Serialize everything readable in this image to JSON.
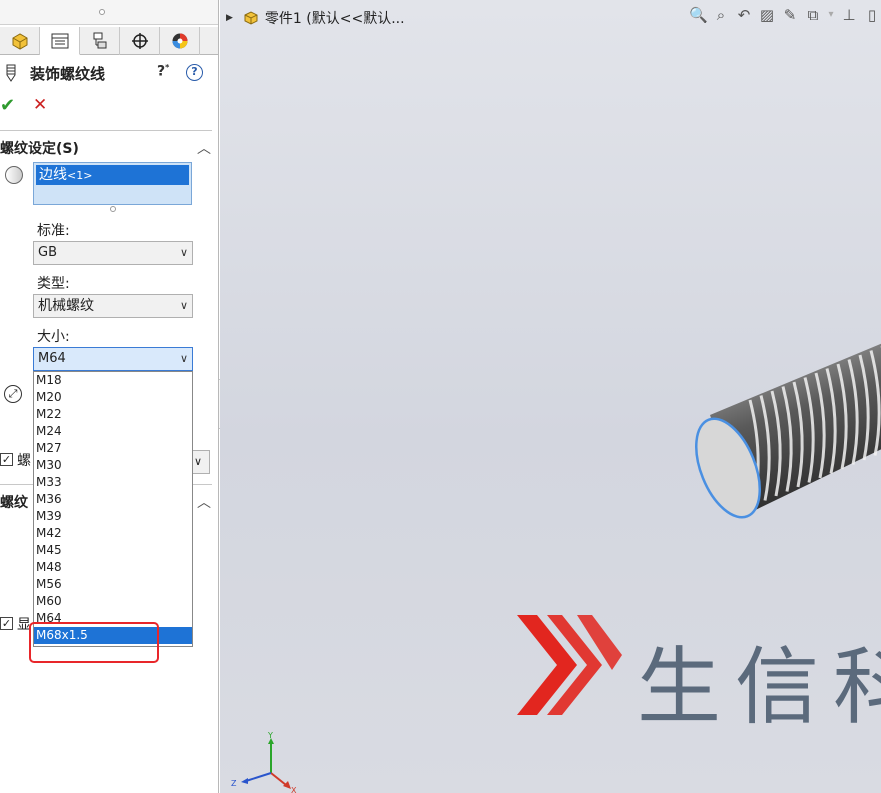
{
  "tabs": [
    {
      "name": "feature-manager-tab",
      "icon": "feature-manager-icon"
    },
    {
      "name": "property-manager-tab",
      "icon": "property-manager-icon"
    },
    {
      "name": "configuration-manager-tab",
      "icon": "configuration-icon"
    },
    {
      "name": "dimxpert-tab",
      "icon": "dimxpert-icon"
    },
    {
      "name": "display-manager-tab",
      "icon": "display-manager-icon"
    }
  ],
  "property_manager": {
    "title": "装饰螺纹线",
    "help_label": "?",
    "help2_label": "?",
    "ok_label": "✔",
    "cancel_label": "✕"
  },
  "thread_settings": {
    "section_title": "螺纹设定(S)",
    "selection_item": "边线",
    "selection_suffix": "<1>",
    "standard_label": "标准:",
    "standard_value": "GB",
    "type_label": "类型:",
    "type_value": "机械螺纹",
    "size_label": "大小:",
    "size_value": "M64",
    "size_options": [
      "M18",
      "M20",
      "M22",
      "M24",
      "M27",
      "M30",
      "M33",
      "M36",
      "M39",
      "M42",
      "M45",
      "M48",
      "M56",
      "M60",
      "M64",
      "M68x1.5"
    ],
    "size_selected": "M68x1.5"
  },
  "partial_labels": {
    "thread_callout": "螺",
    "thread_callout_section": "螺纹",
    "display_checkbox": "显"
  },
  "viewport": {
    "tree_text": "零件1  (默认<<默认...",
    "watermark_text": "生信科",
    "triad_x": "X",
    "triad_y": "Y",
    "triad_z": "Z"
  },
  "colors": {
    "selection_blue": "#1e73d6",
    "highlight_red": "#e8262a",
    "ok_green": "#2e9a2e",
    "cancel_red": "#cc2020",
    "edge_blue": "#4a90e2"
  }
}
